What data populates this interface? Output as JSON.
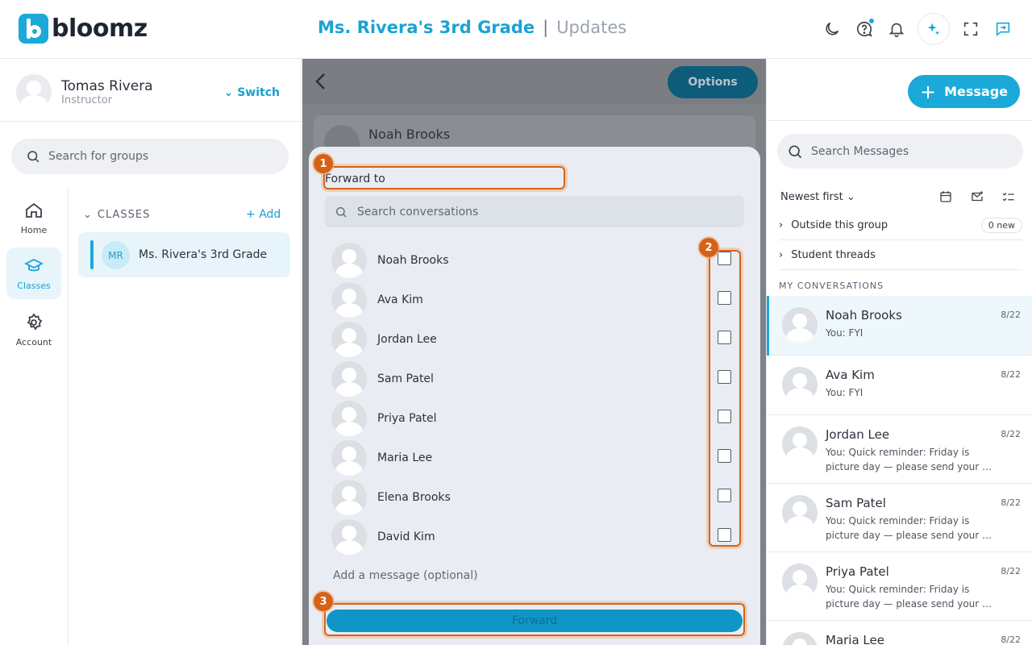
{
  "app": {
    "logo_text": "bloomz",
    "brand_color": "#1aa9d8"
  },
  "header": {
    "class_title": "Ms. Rivera's 3rd Grade",
    "separator": "|",
    "section": "Updates"
  },
  "profile": {
    "name": "Tomas Rivera",
    "role": "Instructor",
    "switch_label": "Switch"
  },
  "left": {
    "group_search_placeholder": "Search for groups",
    "nav": [
      {
        "label": "Home",
        "icon": "home-icon"
      },
      {
        "label": "Classes",
        "icon": "graduation-cap-icon",
        "active": true
      },
      {
        "label": "Account",
        "icon": "gear-icon"
      }
    ],
    "classes_header": "CLASSES",
    "add_label": "Add",
    "class_item": {
      "initials": "MR",
      "name": "Ms. Rivera's 3rd Grade"
    }
  },
  "middle": {
    "options_label": "Options",
    "background_card_name": "Noah Brooks",
    "modal": {
      "forward_to_label": "Forward to",
      "search_placeholder": "Search conversations",
      "recipients": [
        {
          "name": "Noah Brooks"
        },
        {
          "name": "Ava Kim"
        },
        {
          "name": "Jordan Lee"
        },
        {
          "name": "Sam Patel"
        },
        {
          "name": "Priya Patel"
        },
        {
          "name": "Maria Lee"
        },
        {
          "name": "Elena Brooks"
        },
        {
          "name": "David Kim"
        }
      ],
      "add_message_placeholder": "Add a message (optional)",
      "forward_button": "Forward"
    },
    "annotations": [
      "1",
      "2",
      "3"
    ]
  },
  "right": {
    "message_button": "Message",
    "search_placeholder": "Search Messages",
    "sort_label": "Newest first",
    "outside_group": {
      "label": "Outside this group",
      "badge": "0 new"
    },
    "student_threads": "Student threads",
    "my_conversations_header": "MY CONVERSATIONS",
    "conversations": [
      {
        "name": "Noah Brooks",
        "date": "8/22",
        "preview": "You: FYI"
      },
      {
        "name": "Ava Kim",
        "date": "8/22",
        "preview": "You: FYI"
      },
      {
        "name": "Jordan Lee",
        "date": "8/22",
        "preview": "You: Quick reminder: Friday is picture day — please send your …"
      },
      {
        "name": "Sam Patel",
        "date": "8/22",
        "preview": "You: Quick reminder: Friday is picture day — please send your …"
      },
      {
        "name": "Priya Patel",
        "date": "8/22",
        "preview": "You: Quick reminder: Friday is picture day — please send your …"
      },
      {
        "name": "Maria Lee",
        "date": "8/22",
        "preview": ""
      }
    ]
  }
}
